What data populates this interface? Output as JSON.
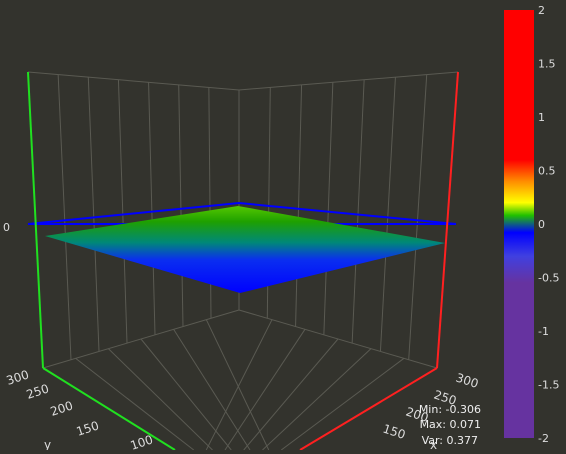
{
  "chart_data": {
    "type": "surface3d",
    "x_axis": {
      "label": "x",
      "ticks": [
        "150",
        "200",
        "250",
        "300"
      ]
    },
    "y_axis": {
      "label": "y",
      "ticks": [
        "100",
        "150",
        "200",
        "250",
        "300"
      ]
    },
    "z_axis": {
      "ticks": [
        "0"
      ]
    },
    "colorbar": {
      "ticks": [
        "2",
        "1.5",
        "1",
        "0.5",
        "0",
        "-0.5",
        "-1",
        "-1.5",
        "-2"
      ],
      "range": [
        -2,
        2
      ],
      "stops": [
        {
          "value": 2,
          "color": "#ff0000"
        },
        {
          "value": 0.6,
          "color": "#ff0000"
        },
        {
          "value": 0.4,
          "color": "#ff8c00"
        },
        {
          "value": 0.2,
          "color": "#ffff00"
        },
        {
          "value": 0.08,
          "color": "#20c000"
        },
        {
          "value": -0.08,
          "color": "#0000ff"
        },
        {
          "value": -0.3,
          "color": "#4040e0"
        },
        {
          "value": -0.55,
          "color": "#6633a0"
        },
        {
          "value": -2,
          "color": "#6633a0"
        }
      ]
    },
    "stats": {
      "min": "Min: -0.306",
      "max": "Max: 0.071",
      "var": "Var: 0.377"
    },
    "reference_plane_z": 0,
    "axis_colors": {
      "x": "#ff2020",
      "y": "#20e020",
      "plane": "#0000ff"
    },
    "grid": true
  }
}
